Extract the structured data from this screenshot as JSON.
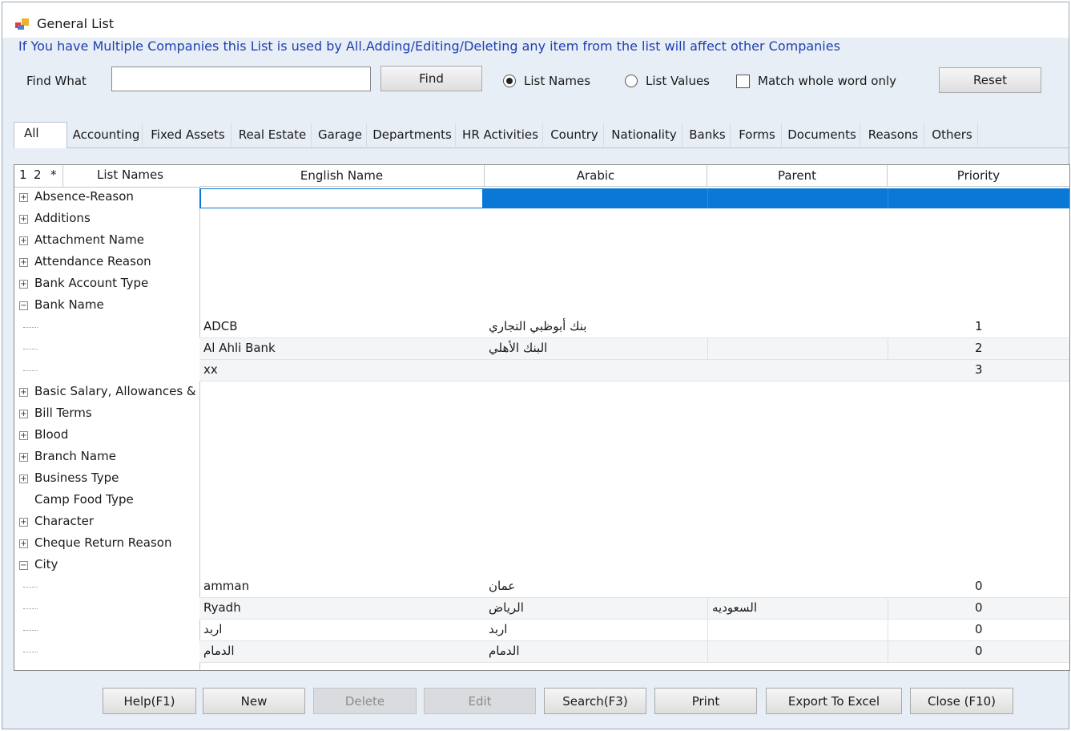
{
  "window": {
    "title": "General List"
  },
  "notice": "If You have Multiple Companies this List is used by All.Adding/Editing/Deleting any item from the list will affect other Companies",
  "search": {
    "find_what_label": "Find What",
    "value": "",
    "find_button": "Find",
    "radio_list_names": "List Names",
    "radio_list_values": "List Values",
    "selected": "List Names",
    "match_whole_word": "Match whole word only",
    "reset_button": "Reset"
  },
  "tabs": [
    "All",
    "Accounting",
    "Fixed Assets",
    "Real Estate",
    "Garage",
    "Departments",
    "HR Activities",
    "Country",
    "Nationality",
    "Banks",
    "Forms",
    "Documents",
    "Reasons",
    "Others"
  ],
  "active_tab": "All",
  "tree": {
    "header": {
      "c1": "1",
      "c2": "2",
      "c3": "*",
      "title": "List Names"
    },
    "nodes": [
      {
        "label": "Absence-Reason",
        "state": "collapsed"
      },
      {
        "label": "Additions",
        "state": "collapsed"
      },
      {
        "label": "Attachment Name",
        "state": "collapsed"
      },
      {
        "label": "Attendance Reason",
        "state": "collapsed"
      },
      {
        "label": "Bank Account Type",
        "state": "collapsed"
      },
      {
        "label": "Bank Name",
        "state": "expanded"
      },
      {
        "label": "Basic Salary, Allowances &",
        "state": "collapsed"
      },
      {
        "label": "Bill Terms",
        "state": "collapsed"
      },
      {
        "label": "Blood",
        "state": "collapsed"
      },
      {
        "label": "Branch Name",
        "state": "collapsed"
      },
      {
        "label": "Business Type",
        "state": "collapsed"
      },
      {
        "label": "Camp Food Type",
        "state": "none"
      },
      {
        "label": "Character",
        "state": "collapsed"
      },
      {
        "label": "Cheque Return Reason",
        "state": "collapsed"
      },
      {
        "label": "City",
        "state": "expanded"
      }
    ]
  },
  "grid": {
    "columns": [
      "English Name",
      "Arabic",
      "Parent",
      "Priority"
    ],
    "bank_rows": [
      {
        "english": "ADCB",
        "arabic": "بنك أبوظبي التجاري",
        "parent": "",
        "priority": "1"
      },
      {
        "english": "Al Ahli Bank",
        "arabic": "البنك الأهلي",
        "parent": "",
        "priority": "2"
      },
      {
        "english": "xx",
        "arabic": "",
        "parent": "",
        "priority": "3"
      }
    ],
    "city_rows": [
      {
        "english": "amman",
        "arabic": "عمان",
        "parent": "",
        "priority": "0"
      },
      {
        "english": "Ryadh",
        "arabic": "الرياض",
        "parent": "السعوديه",
        "priority": "0"
      },
      {
        "english": "اربد",
        "arabic": "اربد",
        "parent": "",
        "priority": "0"
      },
      {
        "english": "الدمام",
        "arabic": "الدمام",
        "parent": "",
        "priority": "0"
      }
    ]
  },
  "buttons": {
    "help": "Help(F1)",
    "new": "New",
    "delete": "Delete",
    "edit": "Edit",
    "search": "Search(F3)",
    "print": "Print",
    "export": "Export To Excel",
    "close": "Close (F10)"
  },
  "colors": {
    "selection": "#0a78d7",
    "notice": "#1f3fb0"
  }
}
